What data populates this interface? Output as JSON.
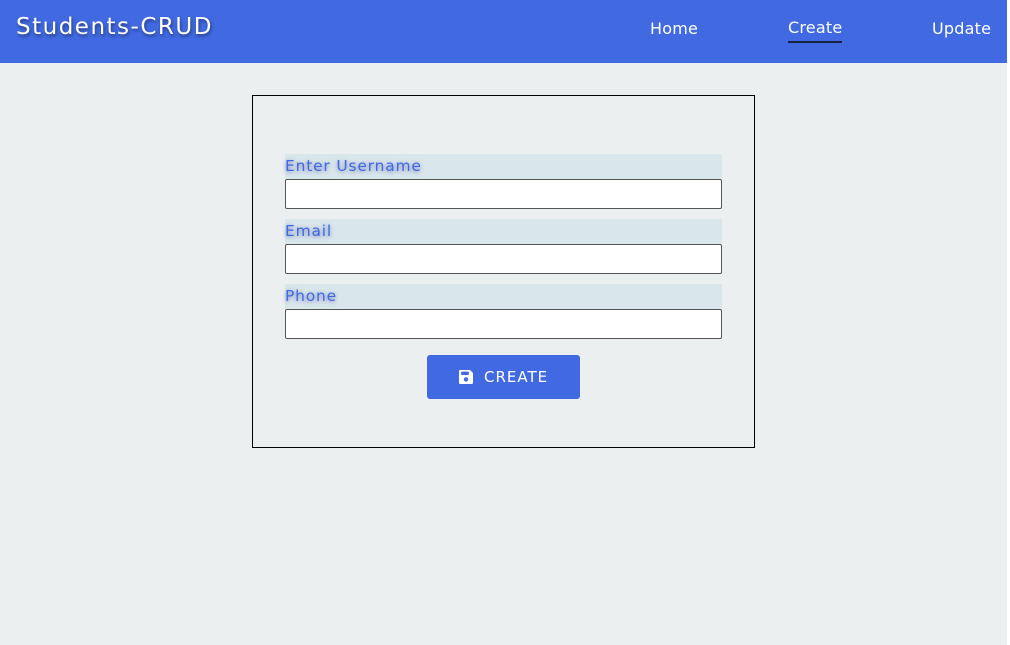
{
  "navbar": {
    "brand": "Students-CRUD",
    "links": [
      {
        "label": "Home",
        "active": false
      },
      {
        "label": "Create",
        "active": true
      },
      {
        "label": "Update",
        "active": false
      }
    ]
  },
  "form": {
    "fields": [
      {
        "label": "Enter Username",
        "value": "",
        "placeholder": ""
      },
      {
        "label": "Email",
        "value": "",
        "placeholder": ""
      },
      {
        "label": "Phone",
        "value": "",
        "placeholder": ""
      }
    ],
    "submit": {
      "label": "CREATE",
      "icon": "floppy-disk-save-icon"
    }
  },
  "colors": {
    "primary": "#4169e1",
    "page_background": "#ebeff0",
    "label_background": "#d9e7ec",
    "card_border": "#000000",
    "active_underline": "#14233f"
  }
}
